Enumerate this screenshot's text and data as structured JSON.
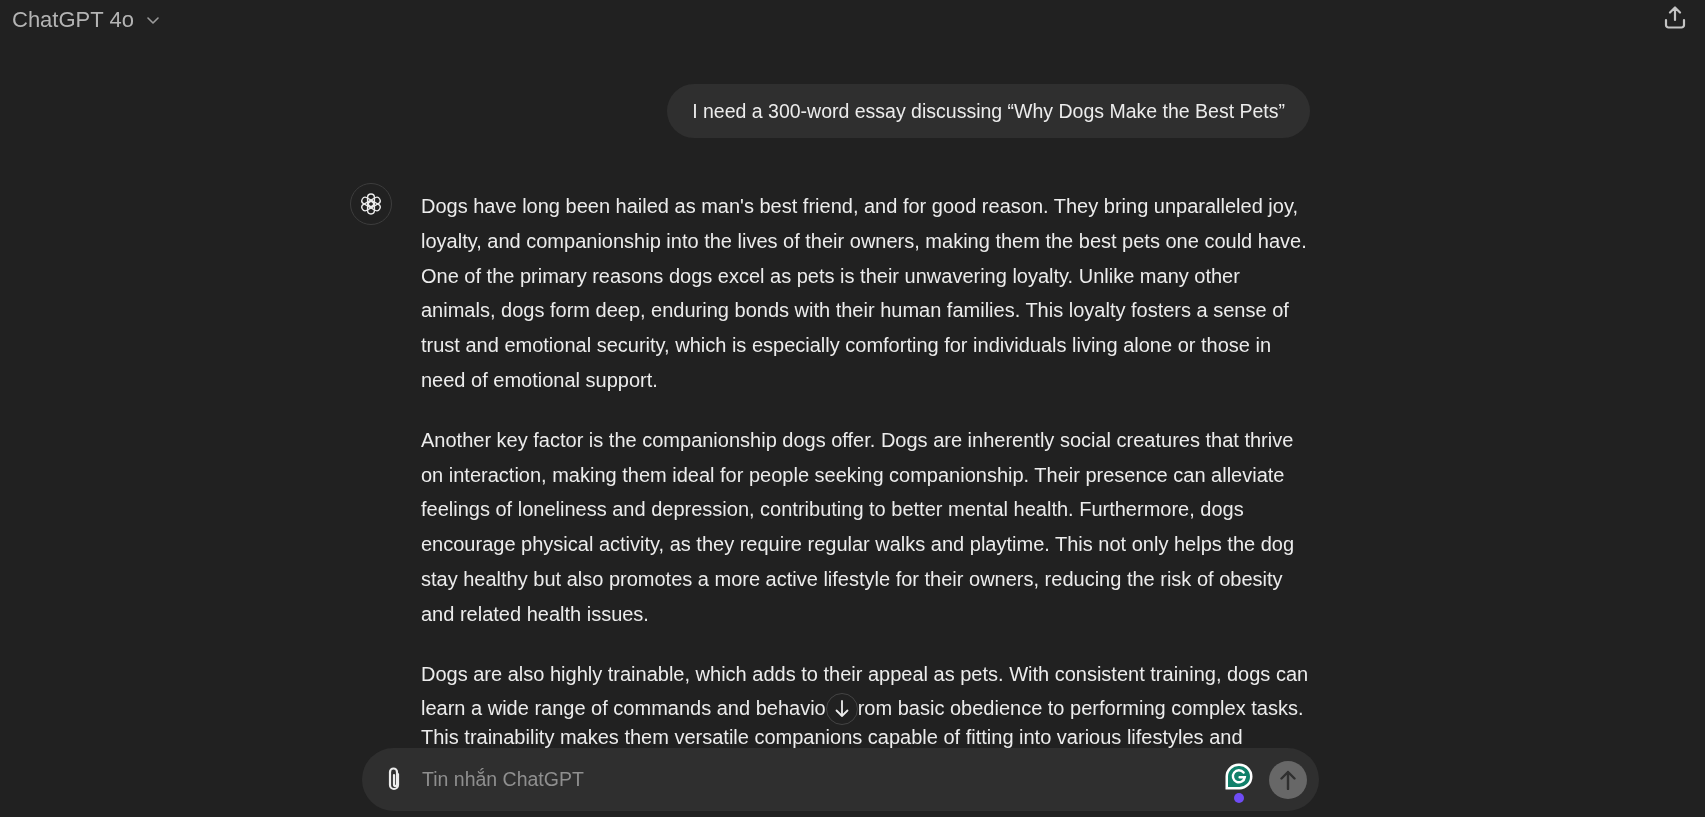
{
  "header": {
    "model": "ChatGPT 4o"
  },
  "messages": [
    {
      "kind": "user",
      "text": "I need a 300-word essay discussing “Why Dogs Make the Best Pets”"
    },
    {
      "kind": "assistant",
      "paragraphs": [
        {
          "kind": "text",
          "text": "Dogs have long been hailed as man's best friend, and for good reason. They bring unparalleled joy, loyalty, and companionship into the lives of their owners, making them the best pets one could have. One of the primary reasons dogs excel as pets is their unwavering loyalty. Unlike many other animals, dogs form deep, enduring bonds with their human families. This loyalty fosters a sense of trust and emotional security, which is especially comforting for individuals living alone or those in need of emotional support."
        },
        {
          "kind": "text",
          "text": "Another key factor is the companionship dogs offer. Dogs are inherently social creatures that thrive on interaction, making them ideal for people seeking companionship. Their presence can alleviate feelings of loneliness and depression, contributing to better mental health. Furthermore, dogs encourage physical activity, as they require regular walks and playtime. This not only helps the dog stay healthy but also promotes a more active lifestyle for their owners, reducing the risk of obesity and related health issues."
        },
        {
          "kind": "lines",
          "lines": [
            {
              "kind": "line",
              "text": "Dogs are also highly trainable, which adds to their appeal as pets. With consistent training, dogs can"
            },
            {
              "kind": "split",
              "before": "learn a wide range of commands and behavio",
              "after": "rom basic obedience to performing complex tasks."
            },
            {
              "kind": "last",
              "text": "This trainability makes them versatile companions capable of fitting into various lifestyles and"
            }
          ]
        }
      ]
    }
  ],
  "composer": {
    "placeholder": "Tin nhắn ChatGPT",
    "send_disabled": true
  }
}
